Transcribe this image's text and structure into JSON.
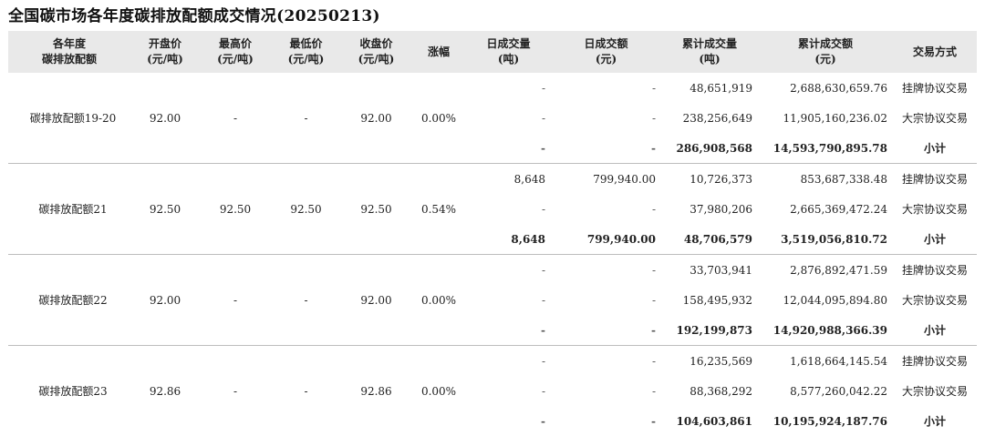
{
  "title": "全国碳市场各年度碳排放配额成交情况(20250213)",
  "headers": [
    [
      "各年度",
      "碳排放配额"
    ],
    [
      "开盘价",
      "(元/吨)"
    ],
    [
      "最高价",
      "(元/吨)"
    ],
    [
      "最低价",
      "(元/吨)"
    ],
    [
      "收盘价",
      "(元/吨)"
    ],
    [
      "涨幅"
    ],
    [
      "日成交量",
      "(吨)"
    ],
    [
      "日成交额",
      "(元)"
    ],
    [
      "累计成交量",
      "(吨)"
    ],
    [
      "累计成交额",
      "(元)"
    ],
    [
      "交易方式"
    ]
  ],
  "groups": [
    {
      "name": "碳排放配额19-20",
      "open": "92.00",
      "high": "-",
      "low": "-",
      "close": "92.00",
      "change": "0.00%",
      "rows": [
        {
          "daily_vol": "-",
          "daily_amt": "-",
          "cum_vol": "48,651,919",
          "cum_amt": "2,688,630,659.76",
          "method": "挂牌协议交易"
        },
        {
          "daily_vol": "-",
          "daily_amt": "-",
          "cum_vol": "238,256,649",
          "cum_amt": "11,905,160,236.02",
          "method": "大宗协议交易"
        },
        {
          "daily_vol": "-",
          "daily_amt": "-",
          "cum_vol": "286,908,568",
          "cum_amt": "14,593,790,895.78",
          "method": "小计"
        }
      ]
    },
    {
      "name": "碳排放配额21",
      "open": "92.50",
      "high": "92.50",
      "low": "92.50",
      "close": "92.50",
      "change": "0.54%",
      "rows": [
        {
          "daily_vol": "8,648",
          "daily_amt": "799,940.00",
          "cum_vol": "10,726,373",
          "cum_amt": "853,687,338.48",
          "method": "挂牌协议交易"
        },
        {
          "daily_vol": "-",
          "daily_amt": "-",
          "cum_vol": "37,980,206",
          "cum_amt": "2,665,369,472.24",
          "method": "大宗协议交易"
        },
        {
          "daily_vol": "8,648",
          "daily_amt": "799,940.00",
          "cum_vol": "48,706,579",
          "cum_amt": "3,519,056,810.72",
          "method": "小计"
        }
      ]
    },
    {
      "name": "碳排放配额22",
      "open": "92.00",
      "high": "-",
      "low": "-",
      "close": "92.00",
      "change": "0.00%",
      "rows": [
        {
          "daily_vol": "-",
          "daily_amt": "-",
          "cum_vol": "33,703,941",
          "cum_amt": "2,876,892,471.59",
          "method": "挂牌协议交易"
        },
        {
          "daily_vol": "-",
          "daily_amt": "-",
          "cum_vol": "158,495,932",
          "cum_amt": "12,044,095,894.80",
          "method": "大宗协议交易"
        },
        {
          "daily_vol": "-",
          "daily_amt": "-",
          "cum_vol": "192,199,873",
          "cum_amt": "14,920,988,366.39",
          "method": "小计"
        }
      ]
    },
    {
      "name": "碳排放配额23",
      "open": "92.86",
      "high": "-",
      "low": "-",
      "close": "92.86",
      "change": "0.00%",
      "rows": [
        {
          "daily_vol": "-",
          "daily_amt": "-",
          "cum_vol": "16,235,569",
          "cum_amt": "1,618,664,145.54",
          "method": "挂牌协议交易"
        },
        {
          "daily_vol": "-",
          "daily_amt": "-",
          "cum_vol": "88,368,292",
          "cum_amt": "8,577,260,042.22",
          "method": "大宗协议交易"
        },
        {
          "daily_vol": "-",
          "daily_amt": "-",
          "cum_vol": "104,603,861",
          "cum_amt": "10,195,924,187.76",
          "method": "小计"
        }
      ]
    }
  ]
}
